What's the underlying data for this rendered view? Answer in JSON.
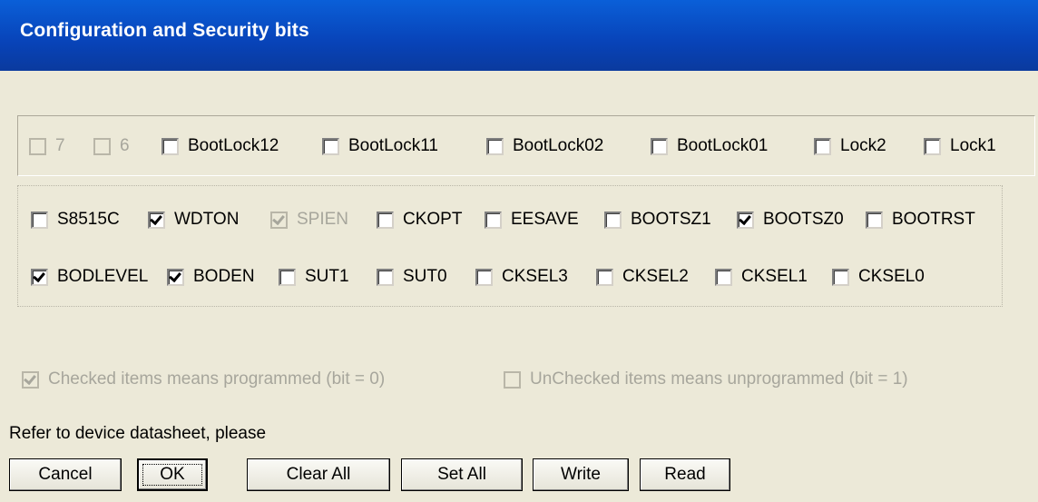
{
  "window": {
    "title": "Configuration and Security bits"
  },
  "lock_bits": [
    {
      "label": "7",
      "checked": false,
      "enabled": false
    },
    {
      "label": "6",
      "checked": false,
      "enabled": false
    },
    {
      "label": "BootLock12",
      "checked": false,
      "enabled": true
    },
    {
      "label": "BootLock11",
      "checked": false,
      "enabled": true
    },
    {
      "label": "BootLock02",
      "checked": false,
      "enabled": true
    },
    {
      "label": "BootLock01",
      "checked": false,
      "enabled": true
    },
    {
      "label": "Lock2",
      "checked": false,
      "enabled": true
    },
    {
      "label": "Lock1",
      "checked": false,
      "enabled": true
    }
  ],
  "fuse_high": [
    {
      "label": "S8515C",
      "checked": false,
      "enabled": true
    },
    {
      "label": "WDTON",
      "checked": true,
      "enabled": true
    },
    {
      "label": "SPIEN",
      "checked": true,
      "enabled": false
    },
    {
      "label": "CKOPT",
      "checked": false,
      "enabled": true
    },
    {
      "label": "EESAVE",
      "checked": false,
      "enabled": true
    },
    {
      "label": "BOOTSZ1",
      "checked": false,
      "enabled": true
    },
    {
      "label": "BOOTSZ0",
      "checked": true,
      "enabled": true
    },
    {
      "label": "BOOTRST",
      "checked": false,
      "enabled": true
    }
  ],
  "fuse_low": [
    {
      "label": "BODLEVEL",
      "checked": true,
      "enabled": true
    },
    {
      "label": "BODEN",
      "checked": true,
      "enabled": true
    },
    {
      "label": "SUT1",
      "checked": false,
      "enabled": true
    },
    {
      "label": "SUT0",
      "checked": false,
      "enabled": true
    },
    {
      "label": "CKSEL3",
      "checked": false,
      "enabled": true
    },
    {
      "label": "CKSEL2",
      "checked": false,
      "enabled": true
    },
    {
      "label": "CKSEL1",
      "checked": false,
      "enabled": true
    },
    {
      "label": "CKSEL0",
      "checked": false,
      "enabled": true
    }
  ],
  "legend": {
    "checked": {
      "label": "Checked items means programmed (bit = 0)",
      "checked": true
    },
    "unchecked": {
      "label": "UnChecked items means unprogrammed (bit = 1)",
      "checked": false
    }
  },
  "note": "Refer to device datasheet, please",
  "buttons": {
    "cancel": "Cancel",
    "ok": "OK",
    "clear_all": "Clear All",
    "set_all": "Set All",
    "write": "Write",
    "read": "Read"
  }
}
